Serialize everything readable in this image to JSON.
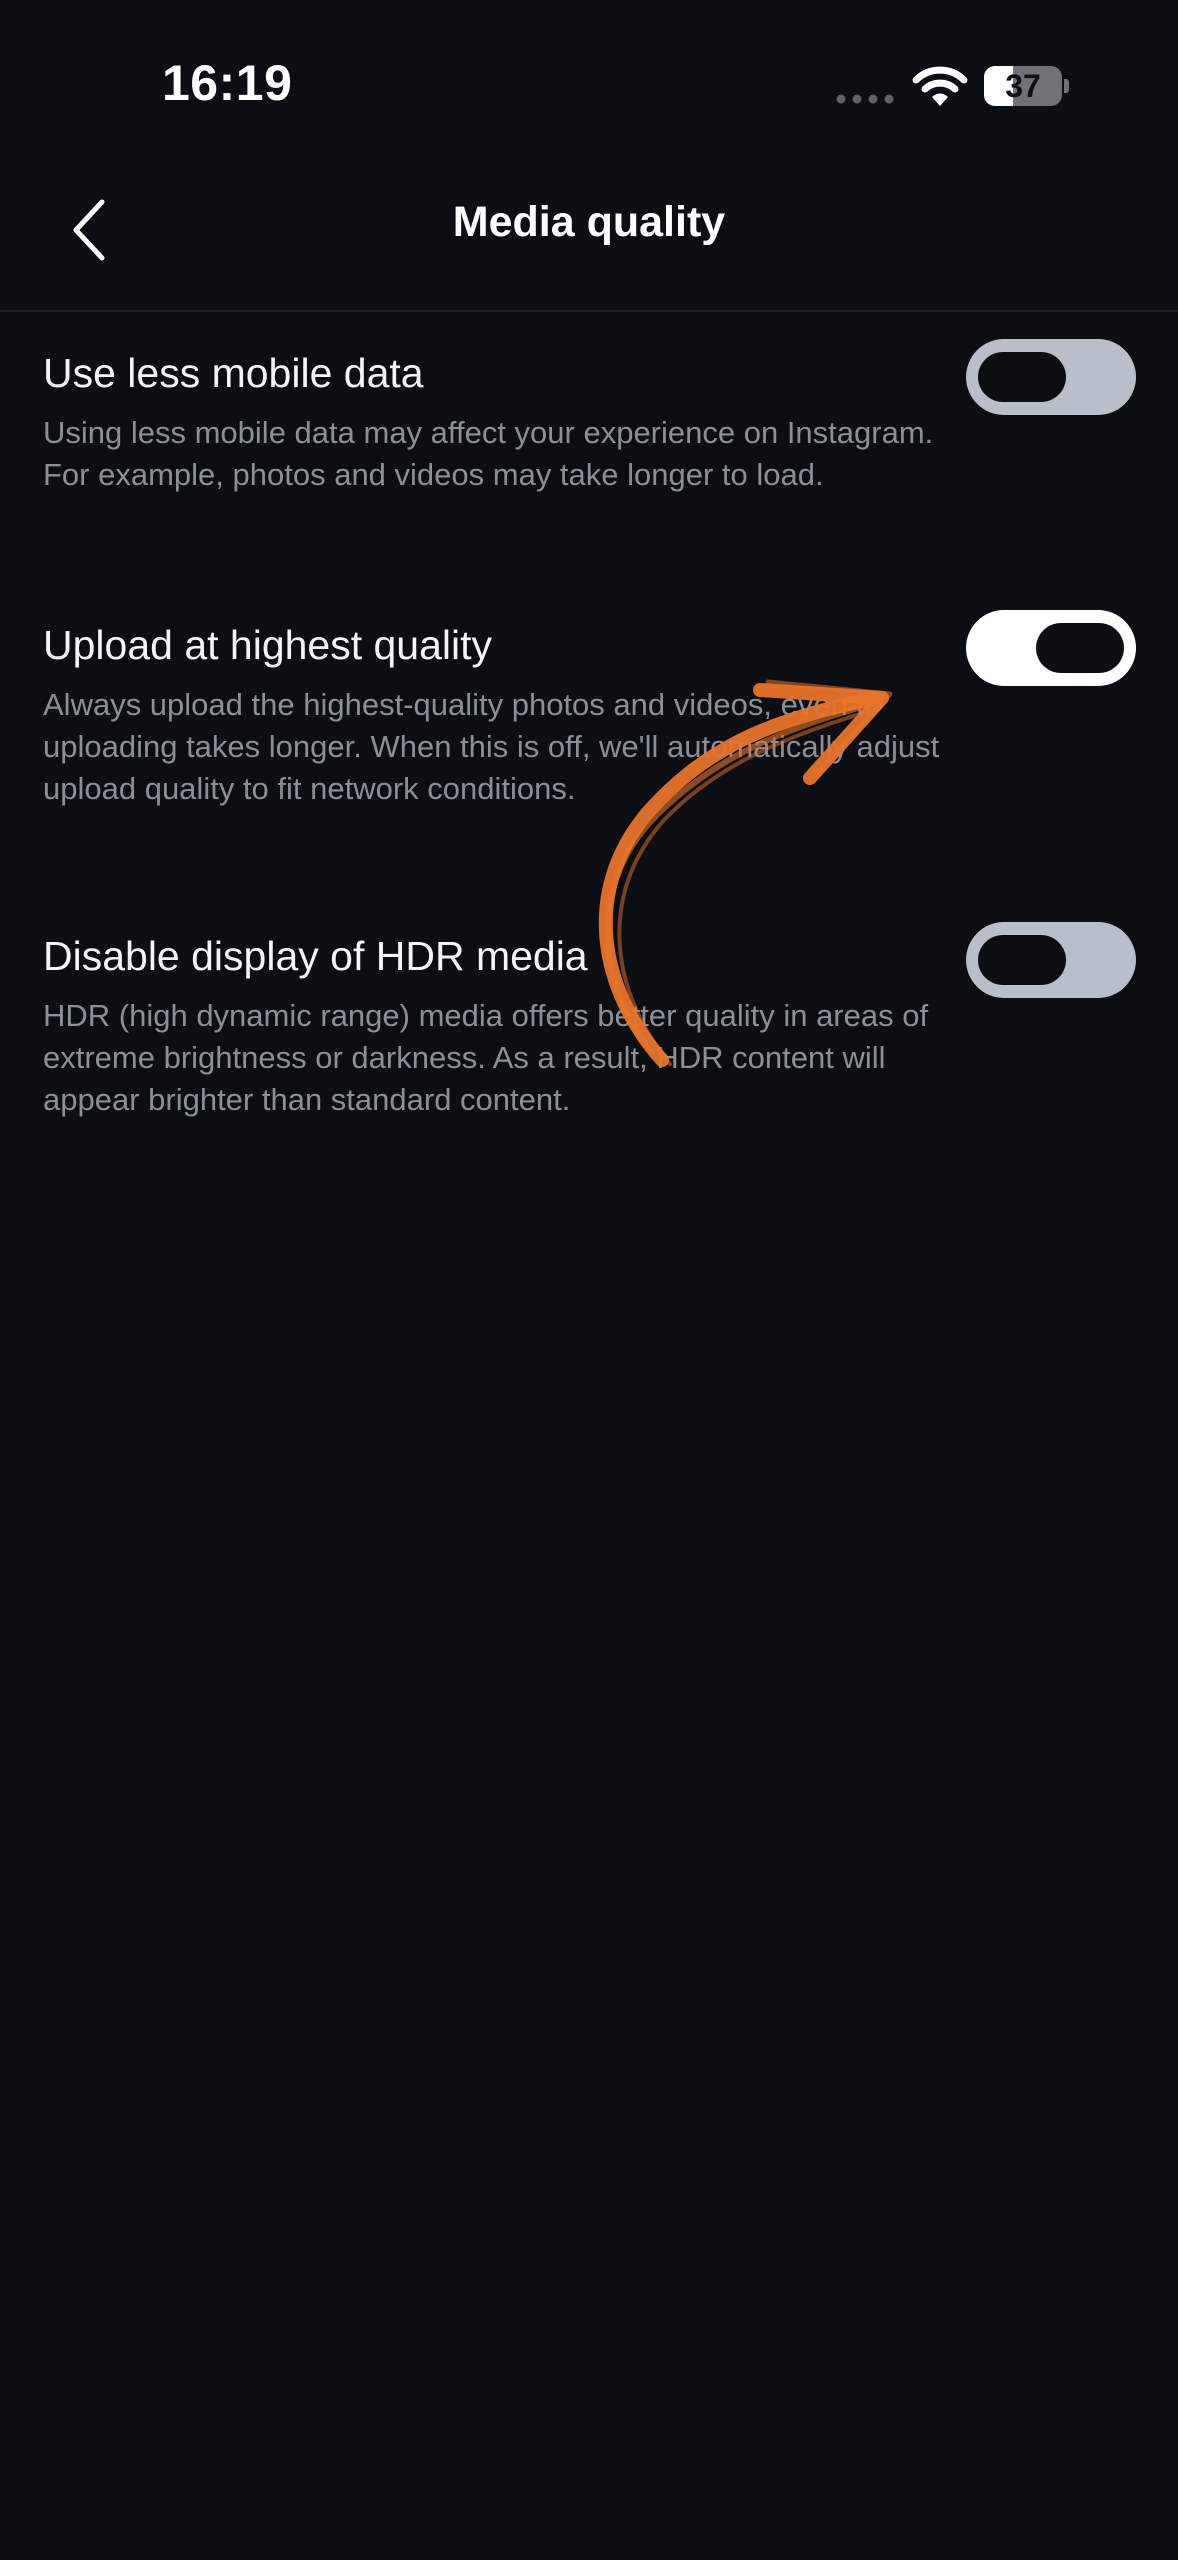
{
  "status_bar": {
    "time": "16:19",
    "battery_level": "37",
    "battery_fraction": 0.37,
    "icons": [
      "signal-dots-icon",
      "wifi-icon",
      "battery-icon"
    ]
  },
  "nav": {
    "back_icon": "chevron-left-icon",
    "title": "Media quality"
  },
  "settings": [
    {
      "title": "Use less mobile data",
      "description": "Using less mobile data may affect your experience on Instagram. For example, photos and videos may take longer to load.",
      "enabled": false
    },
    {
      "title": "Upload at highest quality",
      "description": "Always upload the highest-quality photos and videos, even if uploading takes longer. When this is off, we'll automatically adjust upload quality to fit network conditions.",
      "enabled": true
    },
    {
      "title": "Disable display of HDR media",
      "description": "HDR (high dynamic range) media offers better quality in areas of extreme brightness or darkness. As a result, HDR content will appear brighter than standard content.",
      "enabled": false
    }
  ],
  "annotation": {
    "icon": "curved-arrow-icon",
    "color": "#e8742c"
  },
  "colors": {
    "background": "#0b0e12",
    "text_primary": "#f4f5f7",
    "text_secondary": "#8a8f98",
    "toggle_off": "#b8bfca",
    "toggle_on": "#ffffff"
  }
}
